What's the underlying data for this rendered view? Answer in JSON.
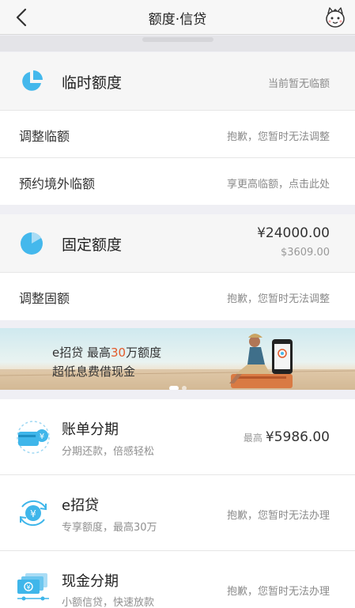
{
  "navbar": {
    "title": "额度·信贷"
  },
  "temporary": {
    "title": "临时额度",
    "status": "当前暂无临额",
    "adjust_label": "调整临额",
    "adjust_status": "抱歉，您暂时无法调整",
    "overseas_label": "预约境外临额",
    "overseas_status": "享更高临额，点击此处"
  },
  "fixed": {
    "title": "固定额度",
    "amount": "¥24000.00",
    "available": "$3609.00",
    "adjust_label": "调整固额",
    "adjust_status": "抱歉，您暂时无法调整"
  },
  "banner": {
    "line1_prefix": "e招贷  最高",
    "line1_highlight": "30",
    "line1_suffix": "万额度",
    "line2": "超低息费借现金"
  },
  "services": [
    {
      "title": "账单分期",
      "subtitle": "分期还款，倍感轻松",
      "amount_prefix": "最高",
      "amount": "¥5986.00"
    },
    {
      "title": "e招贷",
      "subtitle": "专享额度，最高30万",
      "status": "抱歉，您暂时无法办理"
    },
    {
      "title": "现金分期",
      "subtitle": "小额信贷，快速放款",
      "status": "抱歉，您暂时无法办理"
    }
  ],
  "colors": {
    "accent": "#3fb6ea",
    "highlight": "#e25a2b"
  },
  "icons": {
    "back": "chevron-left-icon",
    "mascot": "mascot-avatar-icon",
    "temporary": "pie-chart-icon",
    "fixed": "pie-chart-icon",
    "bill_installment": "card-coin-icon",
    "e_loan": "yuan-cycle-icon",
    "cash_installment": "cash-stack-icon"
  }
}
